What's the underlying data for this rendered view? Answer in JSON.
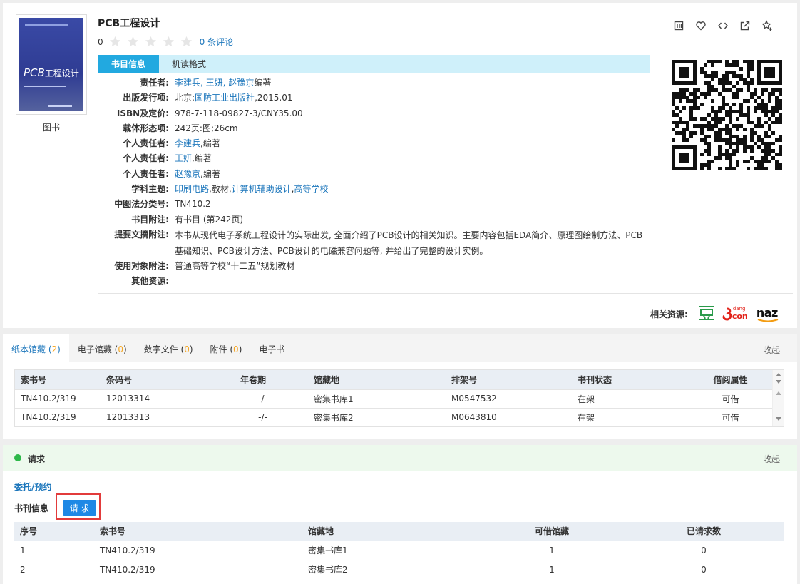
{
  "book": {
    "title": "PCB工程设计",
    "cover_label": "图书",
    "cover_title": "PCB",
    "cover_subtitle": "工程设计",
    "rating_score": "0",
    "reviews_link": "0 条评论"
  },
  "info_tabs": [
    "书目信息",
    "机读格式"
  ],
  "meta": {
    "responsible": {
      "key": "责任者:",
      "links": [
        "李建兵",
        "王妍",
        "赵豫京"
      ],
      "seps": [
        ", ",
        ", "
      ],
      "suffix": "编著"
    },
    "publisher": {
      "key": "出版发行项:",
      "prefix": "北京:",
      "link": "国防工业出版社",
      "suffix": ",2015.01"
    },
    "isbn": {
      "key": "ISBN及定价:",
      "value": "978-7-118-09827-3/CNY35.00"
    },
    "form": {
      "key": "载体形态项:",
      "value": "242页:图;26cm"
    },
    "person1": {
      "key": "个人责任者:",
      "link": "李建兵",
      "suffix": ",编著"
    },
    "person2": {
      "key": "个人责任者:",
      "link": "王妍",
      "suffix": ",编著"
    },
    "person3": {
      "key": "个人责任者:",
      "link": "赵豫京",
      "suffix": ",编著"
    },
    "subject": {
      "key": "学科主题:",
      "link1": "印刷电路",
      "mid1": ",教材,",
      "link2": "计算机辅助设计",
      "mid2": ",",
      "link3": "高等学校"
    },
    "clc": {
      "key": "中图法分类号:",
      "value": "TN410.2"
    },
    "bib_note": {
      "key": "书目附注:",
      "value": "有书目 (第242页)"
    },
    "abstract": {
      "key": "提要文摘附注:",
      "value": "本书从现代电子系统工程设计的实际出发, 全面介绍了PCB设计的相关知识。主要内容包括EDA简介、原理图绘制方法、PCB基础知识、PCB设计方法、PCB设计的电磁兼容问题等, 并给出了完整的设计实例。"
    },
    "audience": {
      "key": "使用对象附注:",
      "value": "普通高等学校“十二五”规划教材"
    },
    "other": {
      "key": "其他资源:",
      "value": ""
    }
  },
  "top_icons": [
    "bookshelf-icon",
    "heart-icon",
    "code-icon",
    "share-icon",
    "star-plus-icon"
  ],
  "related": {
    "label": "相关资源:",
    "douban_glyph": "豆",
    "dangdang_small": "dang",
    "dangdang_big": "con",
    "amazon": "naz"
  },
  "holdings": {
    "tabs": [
      {
        "label": "纸本馆藏",
        "count": "2"
      },
      {
        "label": "电子馆藏",
        "count": "0"
      },
      {
        "label": "数字文件",
        "count": "0"
      },
      {
        "label": "附件",
        "count": "0"
      },
      {
        "label": "电子书",
        "count": ""
      }
    ],
    "collapse": "收起",
    "columns": [
      "索书号",
      "条码号",
      "年卷期",
      "馆藏地",
      "排架号",
      "书刊状态",
      "借阅属性"
    ],
    "rows": [
      [
        "TN410.2/319",
        "12013314",
        "-/-",
        "密集书库1",
        "M0547532",
        "在架",
        "可借"
      ],
      [
        "TN410.2/319",
        "12013313",
        "-/-",
        "密集书库2",
        "M0643810",
        "在架",
        "可借"
      ]
    ]
  },
  "request": {
    "header": "请求",
    "collapse": "收起",
    "link": "委托/预约",
    "info_label": "书刊信息",
    "button": "请 求",
    "columns": [
      "序号",
      "索书号",
      "馆藏地",
      "可借馆藏",
      "已请求数"
    ],
    "rows": [
      [
        "1",
        "TN410.2/319",
        "密集书库1",
        "1",
        "0"
      ],
      [
        "2",
        "TN410.2/319",
        "密集书库2",
        "1",
        "0"
      ]
    ]
  },
  "colors": {
    "link": "#1a75bb",
    "tab_active": "#22a9e0",
    "tab_bar": "#cff0fa",
    "count": "#f5a623",
    "request_button": "#1e88e5",
    "highlight_box": "#e23b3b",
    "status_dot": "#2eb84a"
  }
}
